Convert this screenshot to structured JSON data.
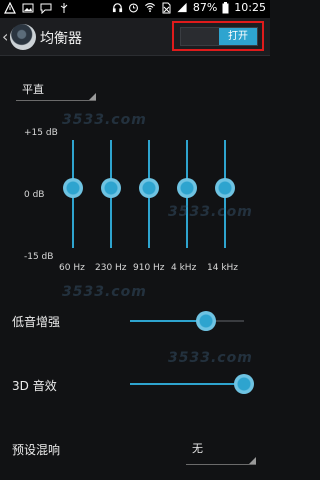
{
  "status_bar": {
    "battery": "87%",
    "time": "10:25"
  },
  "app": {
    "title": "均衡器",
    "toggle_label": "打开"
  },
  "preset": {
    "selected": "平直"
  },
  "equalizer": {
    "max_label": "+15 dB",
    "mid_label": "0 dB",
    "min_label": "-15 dB",
    "bands": [
      {
        "freq": "60 Hz",
        "gain_db": 0
      },
      {
        "freq": "230 Hz",
        "gain_db": 0
      },
      {
        "freq": "910 Hz",
        "gain_db": 0
      },
      {
        "freq": "4 kHz",
        "gain_db": 0
      },
      {
        "freq": "14 kHz",
        "gain_db": 0
      }
    ]
  },
  "bass_boost": {
    "label": "低音增强",
    "value": 0.66
  },
  "virtualizer": {
    "label": "3D 音效",
    "value": 1.0
  },
  "reverb": {
    "label": "预设混响",
    "selected": "无"
  },
  "watermark": "3533.com",
  "colors": {
    "accent": "#2ea4cf",
    "highlight_frame": "#e01b1b"
  }
}
